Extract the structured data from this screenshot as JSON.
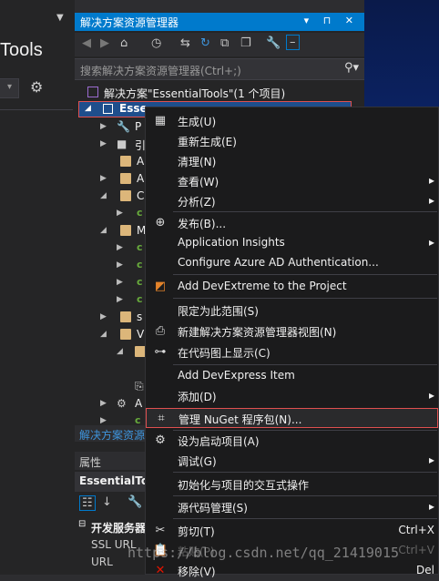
{
  "left_panel": {
    "title": "Tools"
  },
  "solution_explorer": {
    "title": "解决方案资源管理器",
    "title_icons": "▾ ⊓ ✕",
    "search_placeholder": "搜索解决方案资源管理器(Ctrl+;)",
    "solution_label": "解决方案\"EssentialTools\"(1 个项目)",
    "project_label": "Esse",
    "tree_partial": [
      "P",
      "引",
      "A",
      "A",
      "C",
      "c",
      "M",
      "c",
      "c",
      "c",
      "c",
      "s",
      "V",
      "A",
      "c"
    ],
    "bottom_link": "解决方案资源"
  },
  "properties": {
    "title": "属性",
    "object": "EssentialTo",
    "category": "开发服务器",
    "rows": [
      "SSL URL",
      "URL"
    ]
  },
  "context_menu": {
    "items": [
      {
        "label": "生成(U)",
        "icon": "build-icon"
      },
      {
        "label": "重新生成(E)",
        "icon": ""
      },
      {
        "label": "清理(N)",
        "icon": ""
      },
      {
        "label": "查看(W)",
        "icon": ""
      },
      {
        "label": "分析(Z)",
        "icon": ""
      },
      {
        "label": "发布(B)...",
        "icon": "globe-icon"
      },
      {
        "label": "Application Insights",
        "icon": ""
      },
      {
        "label": "Configure Azure AD Authentication...",
        "icon": ""
      },
      {
        "label": "Add DevExtreme to the Project",
        "icon": "devextreme-icon"
      },
      {
        "label": "限定为此范围(S)",
        "icon": ""
      },
      {
        "label": "新建解决方案资源管理器视图(N)",
        "icon": "new-view-icon"
      },
      {
        "label": "在代码图上显示(C)",
        "icon": "code-map-icon"
      },
      {
        "label": "Add DevExpress Item",
        "icon": ""
      },
      {
        "label": "添加(D)",
        "icon": ""
      },
      {
        "label": "管理 NuGet 程序包(N)...",
        "icon": "nuget-icon"
      },
      {
        "label": "设为启动项目(A)",
        "icon": "gear-icon"
      },
      {
        "label": "调试(G)",
        "icon": ""
      },
      {
        "label": "初始化与项目的交互式操作",
        "icon": ""
      },
      {
        "label": "源代码管理(S)",
        "icon": ""
      },
      {
        "label": "剪切(T)",
        "icon": "cut-icon",
        "shortcut": "Ctrl+X"
      },
      {
        "label": "粘贴(P)",
        "icon": "paste-icon",
        "shortcut": "Ctrl+V"
      },
      {
        "label": "移除(V)",
        "icon": "remove-icon",
        "shortcut": "Del"
      }
    ]
  },
  "watermark": "https://blog.csdn.net/qq_21419015"
}
